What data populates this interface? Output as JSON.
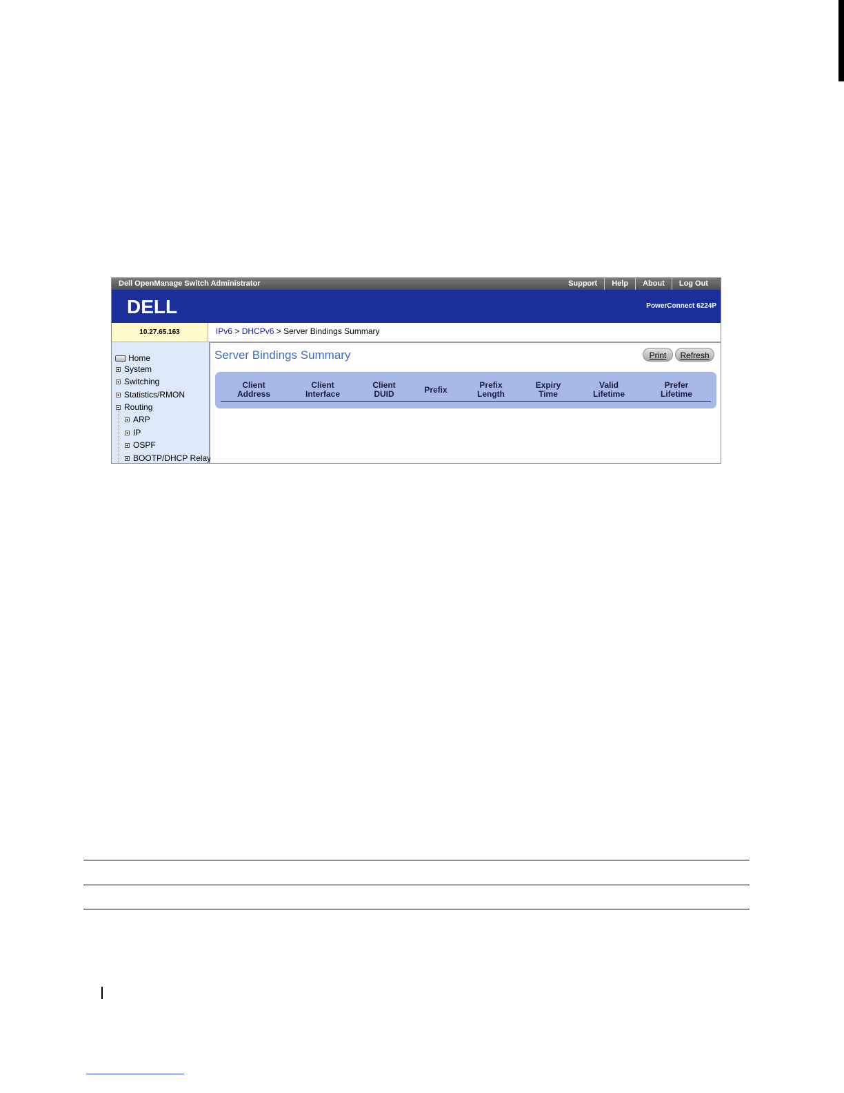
{
  "app": {
    "title": "Dell OpenManage Switch Administrator",
    "links": [
      "Support",
      "Help",
      "About",
      "Log Out"
    ],
    "logo_text": "DELL",
    "model": "PowerConnect 6224P"
  },
  "device_ip": "10.27.65.163",
  "breadcrumb": {
    "items": [
      "IPv6",
      "DHCPv6",
      "Server Bindings Summary"
    ],
    "separator": ">"
  },
  "sidebar": {
    "items": [
      "Home",
      "System",
      "Switching",
      "Statistics/RMON",
      "Routing",
      "ARP",
      "IP",
      "OSPF",
      "BOOTP/DHCP Relay A"
    ]
  },
  "main": {
    "title": "Server Bindings Summary",
    "print_label": "Print",
    "refresh_label": "Refresh",
    "table": {
      "columns": [
        [
          "Client",
          "Address"
        ],
        [
          "Client",
          "Interface"
        ],
        [
          "Client",
          "DUID"
        ],
        [
          "Prefix"
        ],
        [
          "Prefix",
          "Length"
        ],
        [
          "Expiry",
          "Time"
        ],
        [
          "Valid",
          "Lifetime"
        ],
        [
          "Prefer",
          "Lifetime"
        ]
      ],
      "rows": []
    }
  },
  "colors": {
    "banner": "#1b2f9a",
    "accent_title": "#3b6cc6",
    "table_bg": "#a8b8e8",
    "sidebar_bg": "#dde9f8",
    "ip_bg": "#fffbcc",
    "link": "#1a1aa8"
  }
}
